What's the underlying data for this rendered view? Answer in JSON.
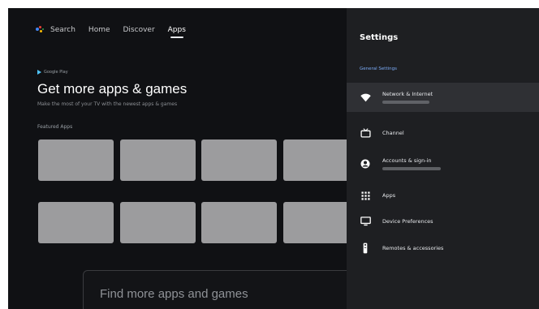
{
  "topnav": {
    "items": [
      {
        "label": "Search"
      },
      {
        "label": "Home"
      },
      {
        "label": "Discover"
      },
      {
        "label": "Apps",
        "active": true
      }
    ]
  },
  "apps_page": {
    "badge": "Google Play",
    "title": "Get more apps & games",
    "subtitle": "Make the most of your TV with the newest apps & games",
    "row_label": "Featured Apps",
    "find_more": "Find more apps and games"
  },
  "settings": {
    "title": "Settings",
    "section_label": "General Settings",
    "items": [
      {
        "label": "Network & Internet",
        "icon": "wifi-icon",
        "has_subtitle": true,
        "highlighted": true
      },
      {
        "label": "Channel",
        "icon": "tv-icon",
        "has_subtitle": false
      },
      {
        "label": "Accounts & sign-in",
        "icon": "account-icon",
        "has_subtitle": true
      },
      {
        "label": "Apps",
        "icon": "apps-grid-icon",
        "has_subtitle": false
      },
      {
        "label": "Device Preferences",
        "icon": "monitor-icon",
        "has_subtitle": false
      },
      {
        "label": "Remotes & accessories",
        "icon": "remote-icon",
        "has_subtitle": false
      }
    ]
  },
  "colors": {
    "background": "#101114",
    "panel": "#1e1f22",
    "highlight": "#2f3034",
    "accent": "#7cacf8",
    "tile": "#9c9c9e"
  }
}
